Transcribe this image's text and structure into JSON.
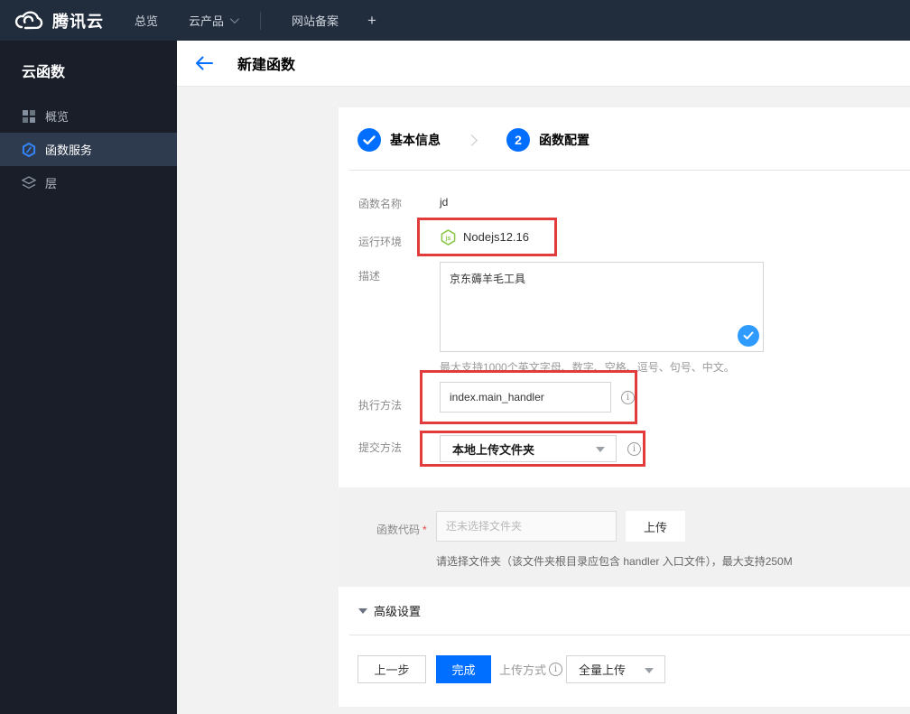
{
  "navbar": {
    "brand": "腾讯云",
    "items": [
      {
        "label": "总览",
        "caret": false
      },
      {
        "label": "云产品",
        "caret": true
      },
      {
        "label": "网站备案",
        "caret": false
      }
    ],
    "plus": "+"
  },
  "sidebar": {
    "title": "云函数",
    "items": [
      {
        "label": "概览",
        "icon": "grid-icon",
        "selected": false
      },
      {
        "label": "函数服务",
        "icon": "scf-hexagon-icon",
        "selected": true
      },
      {
        "label": "层",
        "icon": "layers-icon",
        "selected": false
      }
    ]
  },
  "header": {
    "title": "新建函数"
  },
  "steps": {
    "step1": {
      "label": "基本信息",
      "state": "done"
    },
    "step2": {
      "number": "2",
      "label": "函数配置",
      "state": "current"
    }
  },
  "form": {
    "name": {
      "label": "函数名称",
      "value": "jd"
    },
    "runtime": {
      "label": "运行环境",
      "value": "Nodejs12.16",
      "icon_glyph": "js"
    },
    "description": {
      "label": "描述",
      "value": "京东薅羊毛工具",
      "hint": "最大支持1000个英文字母、数字、空格、逗号、句号、中文。"
    },
    "handler": {
      "label": "执行方法",
      "value": "index.main_handler",
      "info_glyph": "i"
    },
    "submit_method": {
      "label": "提交方法",
      "value": "本地上传文件夹",
      "info_glyph": "i"
    },
    "code": {
      "label": "函数代码",
      "required_mark": "*",
      "placeholder": "还未选择文件夹",
      "upload_button": "上传",
      "hint": "请选择文件夹（该文件夹根目录应包含 handler 入口文件），最大支持250M"
    },
    "advanced_label": "高级设置"
  },
  "footer": {
    "prev_button": "上一步",
    "finish_button": "完成",
    "upload_mode_label": "上传方式",
    "upload_mode_info_glyph": "i",
    "upload_mode_value": "全量上传"
  },
  "colors": {
    "accent_blue": "#006eff",
    "highlight_red": "#e23b3b",
    "node_green": "#8cc84b",
    "check_blue": "#2f9bff",
    "navbar_bg": "#212c3d",
    "sidebar_bg": "#191e28"
  }
}
